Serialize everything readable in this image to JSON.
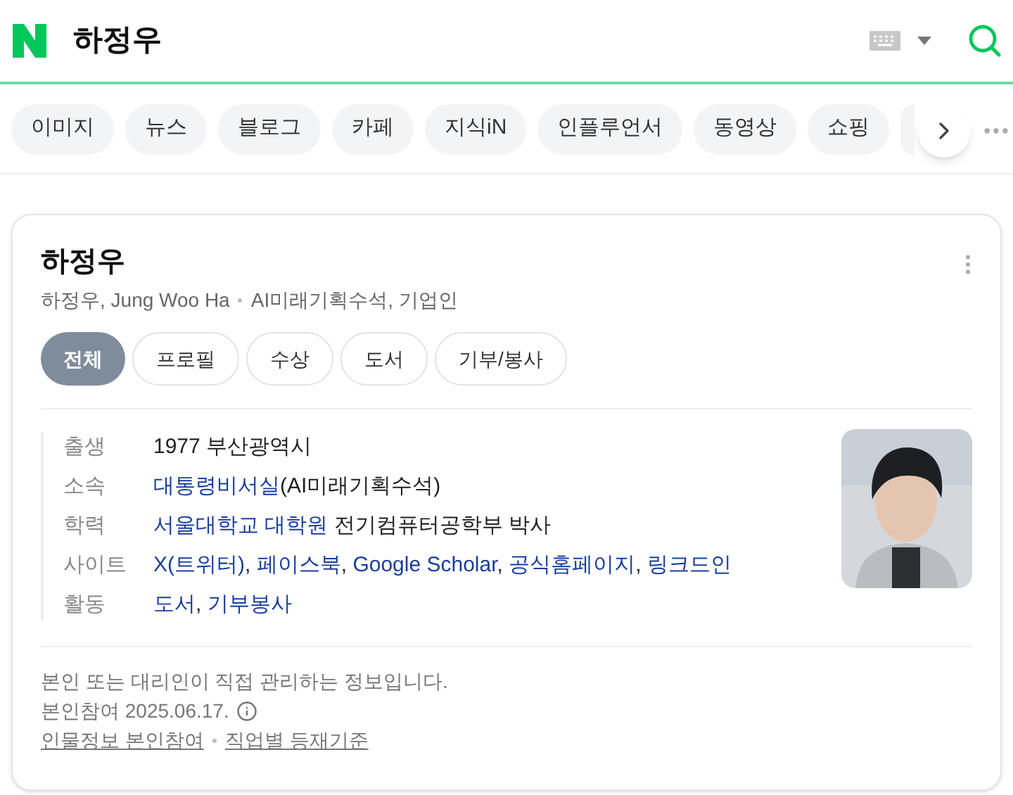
{
  "search": {
    "query": "하정우"
  },
  "categories": [
    {
      "label": "이미지"
    },
    {
      "label": "뉴스"
    },
    {
      "label": "블로그"
    },
    {
      "label": "카페"
    },
    {
      "label": "지식iN"
    },
    {
      "label": "인플루언서"
    },
    {
      "label": "동영상"
    },
    {
      "label": "쇼핑"
    }
  ],
  "profile": {
    "name": "하정우",
    "subtitle": "하정우, Jung Woo Ha",
    "roles": "AI미래기획수석, 기업인",
    "tabs": [
      {
        "label": "전체",
        "selected": true
      },
      {
        "label": "프로필",
        "selected": false
      },
      {
        "label": "수상",
        "selected": false
      },
      {
        "label": "도서",
        "selected": false
      },
      {
        "label": "기부/봉사",
        "selected": false
      }
    ],
    "info": [
      {
        "label": "출생",
        "parts": [
          {
            "text": "1977 부산광역시",
            "link": false
          }
        ]
      },
      {
        "label": "소속",
        "parts": [
          {
            "text": "대통령비서실",
            "link": true
          },
          {
            "text": "(AI미래기획수석)",
            "link": false
          }
        ]
      },
      {
        "label": "학력",
        "parts": [
          {
            "text": "서울대학교 대학원",
            "link": true
          },
          {
            "text": " 전기컴퓨터공학부 박사",
            "link": false
          }
        ]
      },
      {
        "label": "사이트",
        "parts": [
          {
            "text": "X(트위터)",
            "link": true
          },
          {
            "text": ", ",
            "link": false
          },
          {
            "text": "페이스북",
            "link": true
          },
          {
            "text": ", ",
            "link": false
          },
          {
            "text": "Google Scholar",
            "link": true
          },
          {
            "text": ", ",
            "link": false
          },
          {
            "text": "공식홈페이지",
            "link": true
          },
          {
            "text": ", ",
            "link": false
          },
          {
            "text": "링크드인",
            "link": true
          }
        ]
      },
      {
        "label": "활동",
        "parts": [
          {
            "text": "도서",
            "link": true
          },
          {
            "text": ", ",
            "link": false
          },
          {
            "text": "기부봉사",
            "link": true
          }
        ]
      }
    ],
    "photo": {
      "kind": "picture"
    },
    "notice": "본인 또는 대리인이 직접 관리하는 정보입니다.",
    "updated": "본인참여 2025.06.17.",
    "footer_links": [
      "인물정보 본인참여",
      "직업별 등재기준"
    ]
  }
}
